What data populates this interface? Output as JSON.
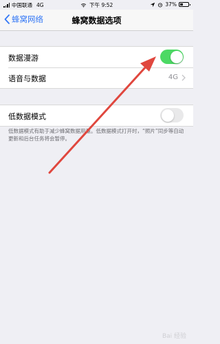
{
  "status_bar": {
    "carrier": "中国联通",
    "network": "4G",
    "time": "下午 9:52",
    "battery_percent": "37%",
    "battery_level": 0.37
  },
  "nav": {
    "back_label": "蜂窝网络",
    "title": "蜂窝数据选项"
  },
  "group1": {
    "roaming_label": "数据漫游",
    "roaming_on": true,
    "voice_label": "语音与数据",
    "voice_value": "4G"
  },
  "group2": {
    "low_data_label": "低数据模式",
    "low_data_on": false,
    "footer": "低数据模式有助于减少蜂窝数据用量。低数据模式打开时，“照片”同步等自动更新和后台任务将会暂停。"
  },
  "colors": {
    "accent": "#3478f6",
    "toggle_on": "#4cd964",
    "arrow": "#e0473e"
  },
  "watermark": "Bai 经验"
}
